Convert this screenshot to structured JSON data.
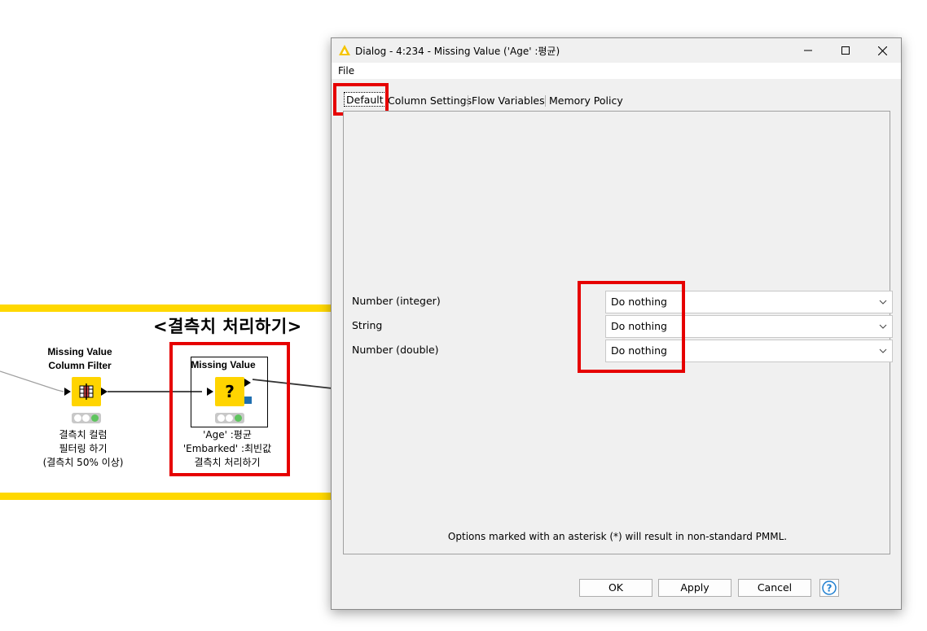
{
  "workflow": {
    "annotation_title": "<결측치 처리하기>",
    "annotation_color": "#ffd800",
    "node1": {
      "title_line1": "Missing Value",
      "title_line2": "Column Filter",
      "label_line1": "결측치 컬럼",
      "label_line2": "필터링 하기",
      "label_line3": "(결측치 50% 이상)",
      "icon": "column-filter-icon"
    },
    "node2": {
      "title": "Missing Value",
      "icon_glyph": "?",
      "label_line1": "'Age' :평균",
      "label_line2": "'Embarked' :최빈값",
      "label_line3": "결측치 처리하기"
    }
  },
  "dialog": {
    "title": "Dialog - 4:234 - Missing Value ('Age' :평균)",
    "menu": {
      "file": "File"
    },
    "tabs": [
      "Default",
      "Column Settings",
      "Flow Variables",
      "Memory Policy"
    ],
    "fields": [
      {
        "label": "Number (integer)",
        "value": "Do nothing"
      },
      {
        "label": "String",
        "value": "Do nothing"
      },
      {
        "label": "Number (double)",
        "value": "Do nothing"
      }
    ],
    "note": "Options marked with an asterisk (*) will result in non-standard PMML.",
    "buttons": {
      "ok": "OK",
      "apply": "Apply",
      "cancel": "Cancel"
    }
  },
  "highlight_color": "#e60000"
}
